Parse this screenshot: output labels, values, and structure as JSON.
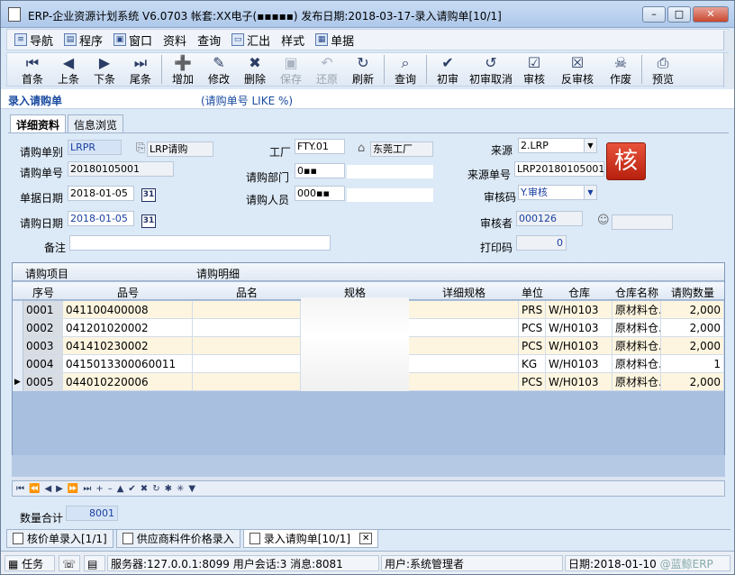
{
  "window": {
    "title": "ERP-企业资源计划系统 V6.0703 帐套:XX电子(▪▪▪▪▪) 发布日期:2018-03-17-录入请购单[10/1]",
    "btn_min": "–",
    "btn_max": "□",
    "btn_close": "✕"
  },
  "menu": [
    {
      "label": "导航",
      "icon": "navigate-icon"
    },
    {
      "label": "程序",
      "icon": "program-icon"
    },
    {
      "label": "窗口",
      "icon": "window-icon"
    },
    {
      "label": "资料",
      "icon": ""
    },
    {
      "label": "查询",
      "icon": ""
    },
    {
      "label": "汇出",
      "icon": "export-icon"
    },
    {
      "label": "样式",
      "icon": ""
    },
    {
      "label": "单据",
      "icon": "document-icon"
    }
  ],
  "toolbar": [
    {
      "label": "首条",
      "glyph": "⏮",
      "enabled": true
    },
    {
      "label": "上条",
      "glyph": "◀",
      "enabled": true
    },
    {
      "label": "下条",
      "glyph": "▶",
      "enabled": true
    },
    {
      "label": "尾条",
      "glyph": "⏭",
      "enabled": true
    },
    {
      "label": "增加",
      "glyph": "➕",
      "enabled": true
    },
    {
      "label": "修改",
      "glyph": "✎",
      "enabled": true
    },
    {
      "label": "删除",
      "glyph": "✖",
      "enabled": true
    },
    {
      "label": "保存",
      "glyph": "▣",
      "enabled": false
    },
    {
      "label": "还原",
      "glyph": "↶",
      "enabled": false
    },
    {
      "label": "刷新",
      "glyph": "↻",
      "enabled": true
    },
    {
      "label": "查询",
      "glyph": "⌕",
      "enabled": true
    },
    {
      "label": "初审",
      "glyph": "✔",
      "enabled": true
    },
    {
      "label": "初审取消",
      "glyph": "↺",
      "enabled": true
    },
    {
      "label": "审核",
      "glyph": "☑",
      "enabled": true
    },
    {
      "label": "反审核",
      "glyph": "☒",
      "enabled": true
    },
    {
      "label": "作废",
      "glyph": "☠",
      "enabled": true
    },
    {
      "label": "预览",
      "glyph": "⎙",
      "enabled": true
    }
  ],
  "page": {
    "title": "录入请购单",
    "query": "(请购单号 LIKE %)"
  },
  "tabs": [
    "详细资料",
    "信息浏览"
  ],
  "form": {
    "type_label": "请购单别",
    "type_value": "LRPR",
    "type_name": "LRP请购",
    "no_label": "请购单号",
    "no_value": "20180105001",
    "date_label": "单据日期",
    "date_value": "2018-01-05",
    "req_date_label": "请购日期",
    "req_date_value": "2018-01-05",
    "remark_label": "备注",
    "factory_label": "工厂",
    "factory_value": "FTY.01",
    "factory_name": "东莞工厂",
    "dept_label": "请购部门",
    "dept_value": "0▪▪",
    "person_label": "请购人员",
    "person_value": "000▪▪",
    "source_label": "来源",
    "source_value": "2.LRP",
    "source_no_label": "来源单号",
    "source_no_value": "LRP20180105001",
    "audit_code_label": "审核码",
    "audit_code_value": "Y.审核",
    "auditor_label": "审核者",
    "auditor_value": "000126",
    "print_label": "打印码",
    "print_value": "0",
    "stamp": "核",
    "calendar_glyph": "31"
  },
  "grid": {
    "group1": "请购项目",
    "group2": "请购明细",
    "columns": [
      "序号",
      "品号",
      "品名",
      "规格",
      "详细规格",
      "单位",
      "仓库",
      "仓库名称",
      "请购数量"
    ],
    "rows": [
      {
        "seq": "0001",
        "item": "041100400008",
        "name": "",
        "spec": "",
        "detail": "",
        "unit": "PRS",
        "wh": "W/H0103",
        "whname": "原材料仓.",
        "qty": "2,000"
      },
      {
        "seq": "0002",
        "item": "041201020002",
        "name": "",
        "spec": "",
        "detail": "",
        "unit": "PCS",
        "wh": "W/H0103",
        "whname": "原材料仓.",
        "qty": "2,000"
      },
      {
        "seq": "0003",
        "item": "041410230002",
        "name": "",
        "spec": "",
        "detail": "",
        "unit": "PCS",
        "wh": "W/H0103",
        "whname": "原材料仓.",
        "qty": "2,000"
      },
      {
        "seq": "0004",
        "item": "0415013300060011",
        "name": "",
        "spec": "",
        "detail": "",
        "unit": "KG",
        "wh": "W/H0103",
        "whname": "原材料仓.",
        "qty": "1"
      },
      {
        "seq": "0005",
        "item": "044010220006",
        "name": "",
        "spec": "",
        "detail": "",
        "unit": "PCS",
        "wh": "W/H0103",
        "whname": "原材料仓.",
        "qty": "2,000"
      }
    ],
    "current_row_marker": "▶",
    "nav": [
      "⏮",
      "⏪",
      "◀",
      "▶",
      "⏩",
      "⏭",
      "+",
      "–",
      "▲",
      "✔",
      "✖",
      "↻",
      "✱",
      "✳",
      "▼"
    ]
  },
  "totals": {
    "label": "数量合计",
    "value": "8001"
  },
  "bottom_tabs": [
    {
      "label": "核价单录入[1/1]",
      "active": false
    },
    {
      "label": "供应商料件价格录入",
      "active": false
    },
    {
      "label": "录入请购单[10/1]",
      "active": true
    }
  ],
  "bottom_tab_close": "✕",
  "status": {
    "task": "任务",
    "server": "服务器:127.0.0.1:8099 用户会话:3 消息:8081",
    "user": "用户:系统管理者",
    "date": "日期:2018-01-10",
    "watermark": "@蓝鲸ERP"
  },
  "colors": {
    "accent": "#1a4ba0",
    "selected_row": "#fdf5df",
    "stamp_red": "#c8321b"
  }
}
